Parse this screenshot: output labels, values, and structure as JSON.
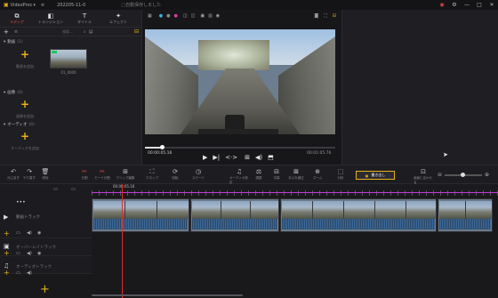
{
  "titlebar": {
    "app_name": "VideoProc",
    "project_name": "202205-11-0",
    "save_status": "□自動保存しました"
  },
  "left_tabs": [
    {
      "label": "メディア",
      "icon": "media-icon"
    },
    {
      "label": "トランジション",
      "icon": "transition-icon"
    },
    {
      "label": "タイトル",
      "icon": "title-icon"
    },
    {
      "label": "エフェクト",
      "icon": "effect-icon"
    }
  ],
  "library": {
    "search_placeholder": "検索...",
    "video_section": "動画",
    "video_count": "(1)",
    "video_add_label": "動画を追加",
    "video_clip_name": "01_0006",
    "image_section": "画像",
    "image_count": "(0)",
    "image_add_label": "画像を追加",
    "audio_section": "オーディオ",
    "audio_count": "(0)",
    "audio_add_label": "オーディオを追加"
  },
  "player": {
    "current_time": "00:00:05.16",
    "total_time": "00:01:05.76",
    "progress_fraction": 0.09
  },
  "toolbar": {
    "tools": [
      {
        "label": "元に戻す",
        "icon": "undo-icon"
      },
      {
        "label": "やり直す",
        "icon": "redo-icon"
      },
      {
        "label": "削除",
        "icon": "delete-icon"
      },
      {
        "label": "分割",
        "icon": "split-icon"
      },
      {
        "label": "モード分割",
        "icon": "mode-split-icon"
      },
      {
        "label": "クリップ編集",
        "icon": "clip-edit-icon"
      },
      {
        "label": "クロップ",
        "icon": "crop-icon"
      },
      {
        "label": "回転",
        "icon": "rotate-icon"
      },
      {
        "label": "スピード",
        "icon": "speed-icon"
      },
      {
        "label": "オーディオ設定",
        "icon": "audio-settings-icon"
      },
      {
        "label": "調整",
        "icon": "adjust-icon"
      },
      {
        "label": "字幕",
        "icon": "subtitle-icon"
      },
      {
        "label": "手ぶれ補正",
        "icon": "stabilize-icon"
      },
      {
        "label": "ズーム",
        "icon": "zoom-tool-icon"
      },
      {
        "label": "分析",
        "icon": "analyze-icon"
      },
      {
        "label": "書き出し",
        "icon": "export-icon"
      },
      {
        "label": "画面に合わせる",
        "icon": "fit-icon"
      }
    ],
    "timeline_time": "00:00:05.16"
  },
  "tracks": {
    "main_video": "動画トラック",
    "overlay": "オーバーレイトラック",
    "audio": "オーディオトラック"
  },
  "colors": {
    "accent": "#e8b21c",
    "playhead": "#e02a2a",
    "tab_active": "#ff4d4d"
  }
}
